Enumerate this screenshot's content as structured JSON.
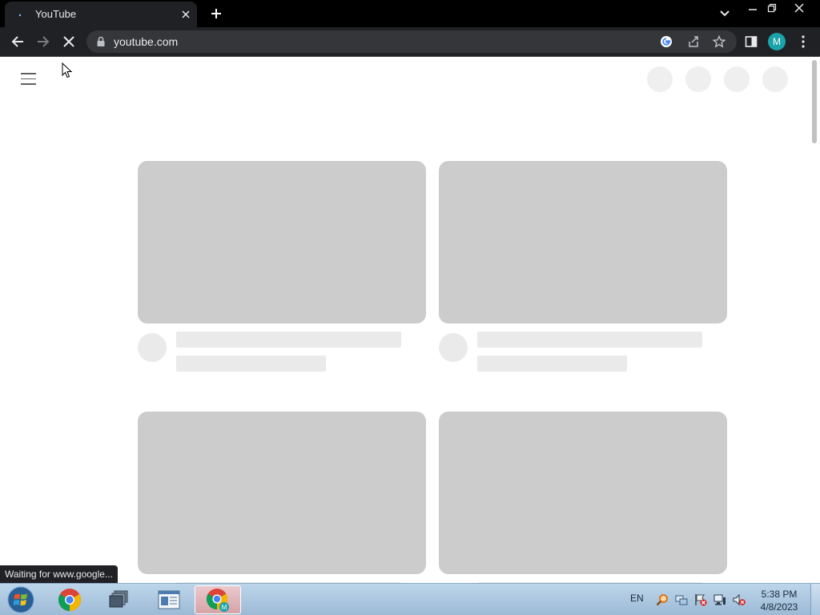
{
  "browser": {
    "tab": {
      "title": "YouTube"
    },
    "address": {
      "url": "youtube.com"
    },
    "profile_initial": "M",
    "status_text": "Waiting for www.google..."
  },
  "colors": {
    "skeleton_thumb": "#cccccc",
    "skeleton_line": "#eaeaea",
    "chrome_dark": "#202124",
    "avatar_bg": "#1aa3a8"
  },
  "icons": {
    "back": "arrow-left-icon",
    "forward": "arrow-right-icon",
    "stop": "close-icon",
    "lock": "lock-icon",
    "google": "google-g-icon",
    "share": "share-icon",
    "bookmark": "star-icon",
    "side_panel": "side-panel-icon",
    "menu": "kebab-menu-icon"
  },
  "page": {
    "skeleton_cards": 4
  },
  "taskbar": {
    "language": "EN",
    "time": "5:38 PM",
    "date": "4/8/2023"
  }
}
